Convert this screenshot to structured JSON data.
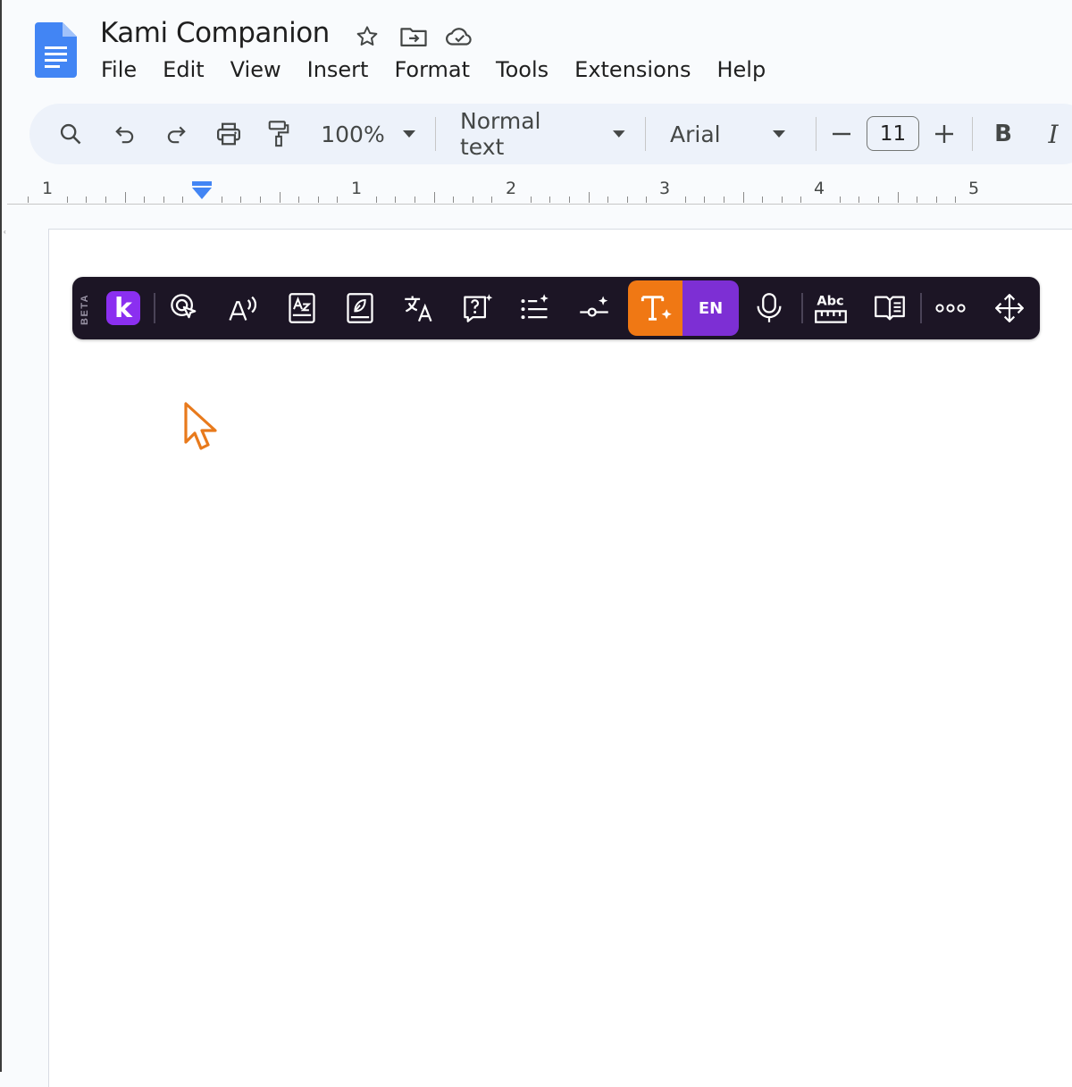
{
  "document": {
    "title": "Kami Companion"
  },
  "menu": [
    "File",
    "Edit",
    "View",
    "Insert",
    "Format",
    "Tools",
    "Extensions",
    "Help"
  ],
  "toolbar": {
    "zoom": "100%",
    "style": "Normal text",
    "font": "Arial",
    "font_size": "11",
    "bold_label": "B",
    "italic_label": "I"
  },
  "ruler": {
    "labels": [
      "1",
      "1",
      "2",
      "3",
      "4",
      "5"
    ]
  },
  "kami": {
    "beta_label": "BETA",
    "logo_letter": "k",
    "language": "EN",
    "colors": {
      "bar": "#1c1525",
      "accent_purple": "#8b2ff0",
      "accent_orange": "#f07814"
    },
    "icons": [
      "select-icon",
      "read-aloud-icon",
      "dictionary-icon",
      "reading-guide-icon",
      "translate-icon",
      "question-icon",
      "summarize-icon",
      "adjust-text-icon",
      "text-simplify-icon",
      "microphone-icon",
      "spell-check-icon",
      "immersive-reader-icon",
      "more-icon",
      "move-icon"
    ]
  }
}
